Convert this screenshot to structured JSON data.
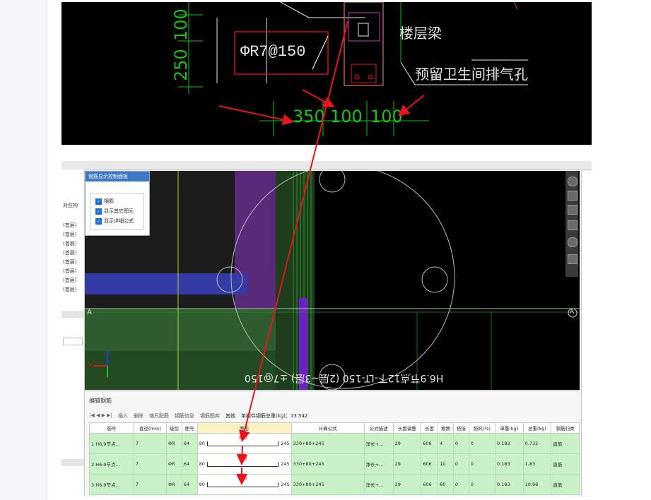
{
  "cad_top": {
    "spec": "ΦR7@150",
    "beam_label": "楼层梁",
    "hole_label": "预留卫生间排气孔",
    "dims_v": [
      "250",
      "100"
    ],
    "dims_h": [
      "350",
      "100",
      "100"
    ]
  },
  "left_panel": {
    "header": "对应构",
    "items": [
      "(首层)",
      "(首层)",
      "(首层)",
      "(首层)",
      "(首层)",
      "(首层)",
      "(首层)",
      "(首层)"
    ]
  },
  "control_panel": {
    "title": "钢筋显示控制面板",
    "options": [
      "钢筋",
      "显示其它图元",
      "显示详细公式"
    ]
  },
  "viewport": {
    "axis_a": "A",
    "axis_x": "X",
    "mirrored_caption": "H6.9节点12下-LT-150 (2层~3层) ±7@150"
  },
  "editor": {
    "title": "编辑钢筋",
    "toolbar": [
      "插入",
      "删除",
      "缩尺配筋",
      "钢筋信息",
      "钢筋图库",
      "其他"
    ],
    "total_weight": "单构件钢筋总重(kg)：13.542",
    "columns": [
      "筋号",
      "直径(mm)",
      "级别",
      "图号",
      "图形",
      "计算公式",
      "公式描述",
      "长度调整",
      "长度",
      "根数",
      "搭接",
      "损耗(%)",
      "单重(kg)",
      "总重(kg)",
      "钢筋归类"
    ],
    "rows": [
      {
        "no": "1",
        "name": "H6.9节点…",
        "dia": "7",
        "grade": "ΦR",
        "fig": "64",
        "left": "80",
        "mid": "330",
        "right": "245",
        "formula": "330+80+245",
        "desc": "净长+…",
        "adj": "29",
        "len": "606",
        "count": "4",
        "lap": "0",
        "loss": "0",
        "unit": "0.183",
        "total": "0.732",
        "cls": "直筋"
      },
      {
        "no": "2",
        "name": "H6.9节点…",
        "dia": "7",
        "grade": "ΦR",
        "fig": "64",
        "left": "80",
        "mid": "330",
        "right": "245",
        "formula": "330+80+245",
        "desc": "净长+…",
        "adj": "29",
        "len": "606",
        "count": "10",
        "lap": "0",
        "loss": "0",
        "unit": "0.183",
        "total": "1.83",
        "cls": "直筋"
      },
      {
        "no": "3",
        "name": "H6.9节点…",
        "dia": "7",
        "grade": "ΦR",
        "fig": "64",
        "left": "80",
        "mid": "330",
        "right": "245",
        "formula": "330+80+245",
        "desc": "净长+…",
        "adj": "29",
        "len": "606",
        "count": "60",
        "lap": "0",
        "loss": "0",
        "unit": "0.183",
        "total": "10.98",
        "cls": "直筋"
      }
    ]
  },
  "colors": {
    "annotation": "#e8131c",
    "cad_green": "#19c219",
    "cad_white": "#e6e6e6",
    "row_green": "#c9f2c9"
  }
}
